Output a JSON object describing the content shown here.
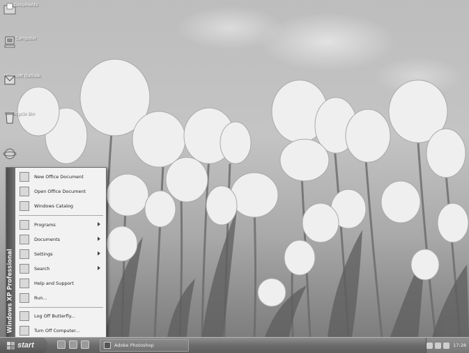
{
  "desktop": {
    "icons": [
      {
        "label": "My Documents",
        "icon": "folder-documents-icon"
      },
      {
        "label": "My Computer",
        "icon": "computer-icon"
      },
      {
        "label": "Microsoft Outlook",
        "icon": "outlook-icon"
      },
      {
        "label": "Recycle Bin",
        "icon": "recycle-bin-icon"
      },
      {
        "label": "",
        "icon": "internet-explorer-icon"
      }
    ]
  },
  "start_menu": {
    "banner": "Windows XP Professional",
    "items": [
      {
        "label": "New Office Document",
        "icon": "new-document-icon",
        "submenu": false
      },
      {
        "label": "Open Office Document",
        "icon": "open-document-icon",
        "submenu": false
      },
      {
        "label": "Windows Catalog",
        "icon": "catalog-icon",
        "submenu": false
      },
      {
        "label": "Programs",
        "icon": "programs-icon",
        "submenu": true
      },
      {
        "label": "Documents",
        "icon": "documents-icon",
        "submenu": true
      },
      {
        "label": "Settings",
        "icon": "settings-icon",
        "submenu": true
      },
      {
        "label": "Search",
        "icon": "search-icon",
        "submenu": true
      },
      {
        "label": "Help and Support",
        "icon": "help-icon",
        "submenu": false
      },
      {
        "label": "Run...",
        "icon": "run-icon",
        "submenu": false
      },
      {
        "label": "Log Off Butterfly...",
        "icon": "log-off-icon",
        "submenu": false
      },
      {
        "label": "Turn Off Computer...",
        "icon": "power-icon",
        "submenu": false
      }
    ]
  },
  "taskbar": {
    "start_label": "start",
    "tasks": [
      {
        "label": "Adobe Photoshop",
        "icon": "photoshop-icon"
      }
    ],
    "clock": "17:28"
  }
}
